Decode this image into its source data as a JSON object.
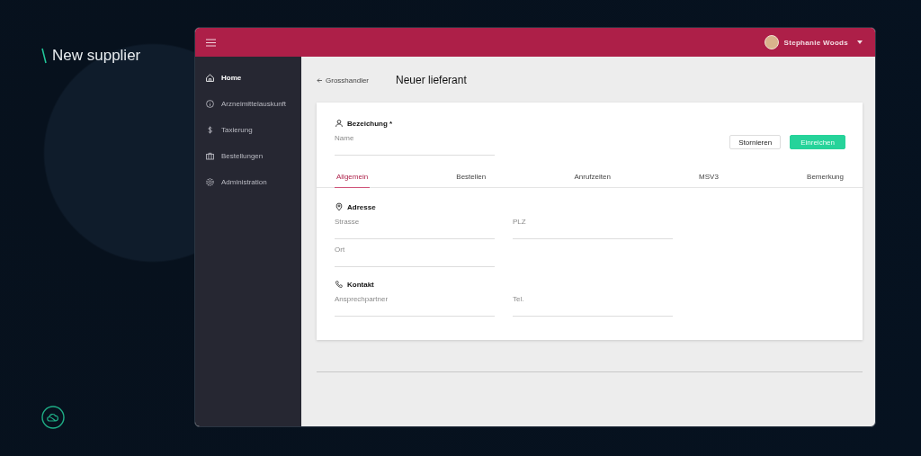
{
  "brand": {
    "title": "New supplier"
  },
  "header": {
    "user": "Stephanie Woods"
  },
  "sidebar": {
    "items": [
      {
        "label": "Home",
        "selected": true
      },
      {
        "label": "Arzneimittelauskunft",
        "selected": false
      },
      {
        "label": "Taxierung",
        "selected": false
      },
      {
        "label": "Bestellungen",
        "selected": false
      },
      {
        "label": "Administration",
        "selected": false
      }
    ]
  },
  "breadcrumb": "Grosshandler",
  "page_title": "Neuer lieferant",
  "name_section": {
    "title": "Bezeichung *",
    "field_label": "Name"
  },
  "buttons": [
    {
      "label": "Stornieren",
      "kind": "secondary"
    },
    {
      "label": "Einreichen",
      "kind": "primary"
    }
  ],
  "tabs": [
    {
      "label": "Allgemein",
      "selected": true
    },
    {
      "label": "Bestellen",
      "selected": false
    },
    {
      "label": "Anrufzeiten",
      "selected": false
    },
    {
      "label": "MSV3",
      "selected": false
    },
    {
      "label": "Bemerkung",
      "selected": false
    }
  ],
  "sections": [
    {
      "title": "Adresse",
      "fields": [
        {
          "label": "Strasse"
        },
        {
          "label": "PLZ"
        },
        {
          "label": "Ort"
        }
      ]
    },
    {
      "title": "Kontakt",
      "fields": [
        {
          "label": "Ansprechpartner"
        },
        {
          "label": "Tel."
        }
      ]
    }
  ]
}
